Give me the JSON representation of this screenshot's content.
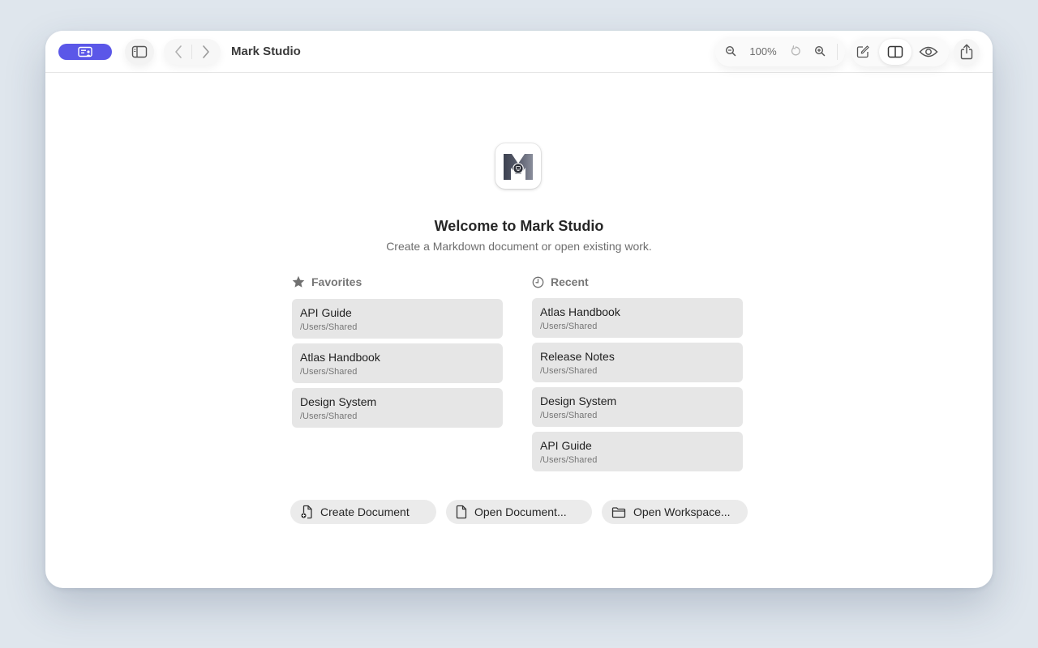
{
  "titlebar": {
    "app_title": "Mark Studio",
    "zoom_level": "100%",
    "accent_color": "#5b57e8",
    "icons": {
      "accent_button": "window-user-icon",
      "sidebar_toggle": "sidebar-icon",
      "back": "chevron-left-icon",
      "forward": "chevron-right-icon",
      "zoom_out": "zoom-out-icon",
      "zoom_reset": "rotate-icon",
      "zoom_in": "zoom-in-icon",
      "edit": "compose-icon",
      "split": "split-view-icon",
      "preview": "eye-icon",
      "share": "share-icon"
    }
  },
  "welcome": {
    "title": "Welcome to Mark Studio",
    "subtitle": "Create a Markdown document or open existing work."
  },
  "favorites": {
    "heading": "Favorites",
    "items": [
      {
        "name": "API Guide",
        "path": "/Users/Shared"
      },
      {
        "name": "Atlas Handbook",
        "path": "/Users/Shared"
      },
      {
        "name": "Design System",
        "path": "/Users/Shared"
      }
    ]
  },
  "recent": {
    "heading": "Recent",
    "items": [
      {
        "name": "Atlas Handbook",
        "path": "/Users/Shared"
      },
      {
        "name": "Release Notes",
        "path": "/Users/Shared"
      },
      {
        "name": "Design System",
        "path": "/Users/Shared"
      },
      {
        "name": "API Guide",
        "path": "/Users/Shared"
      }
    ]
  },
  "actions": {
    "create": "Create Document",
    "open": "Open Document...",
    "workspace": "Open Workspace..."
  }
}
